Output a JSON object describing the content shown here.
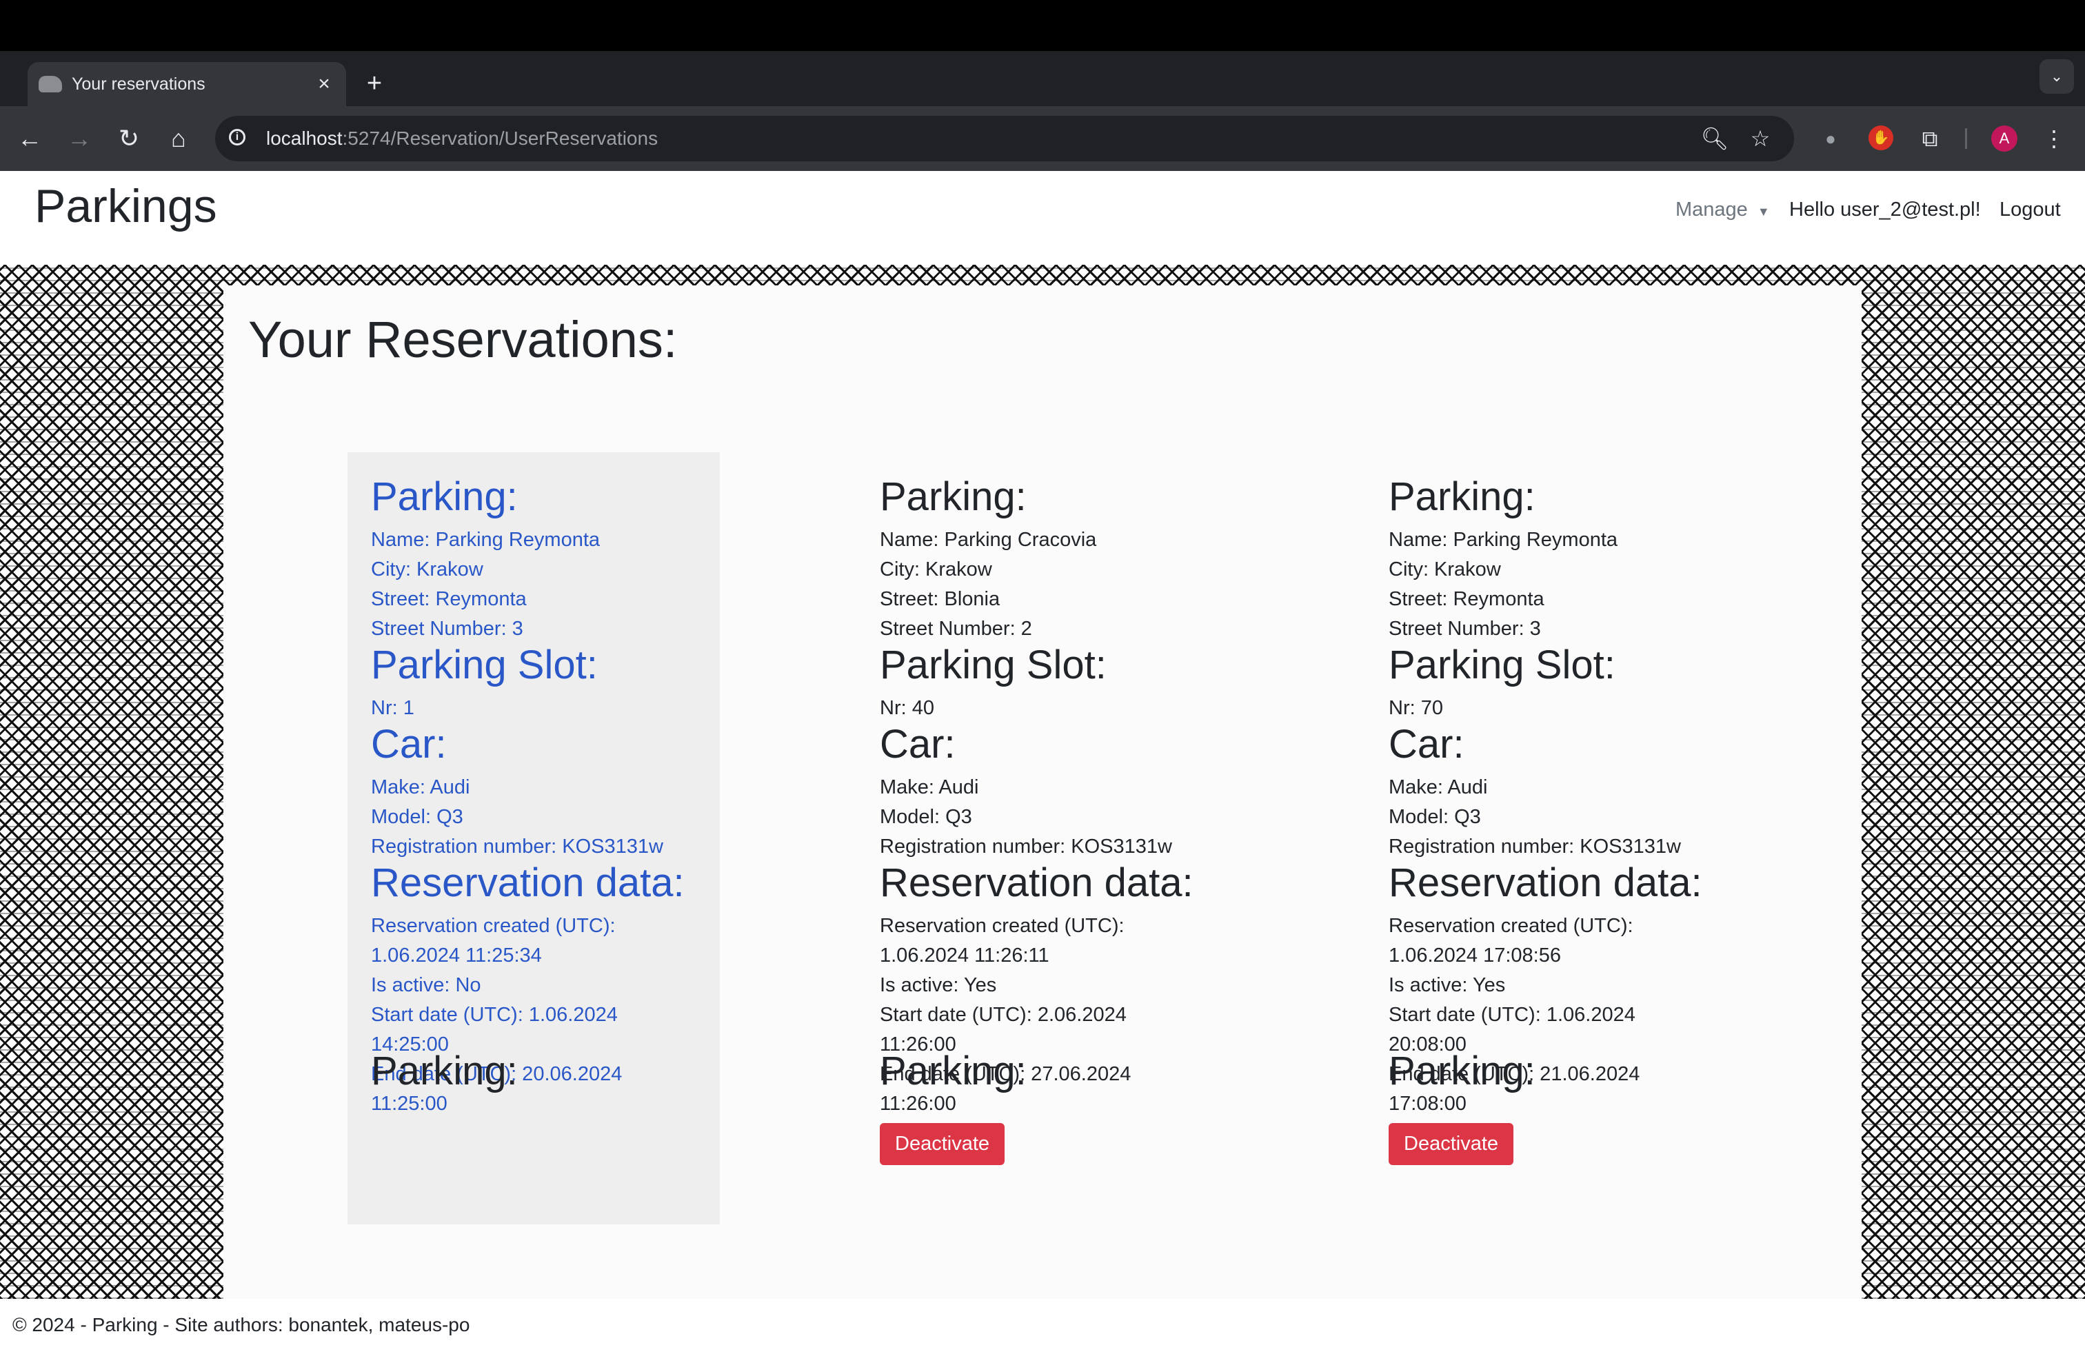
{
  "browser": {
    "tab_title": "Your reservations",
    "tab_close": "×",
    "new_tab": "+",
    "url_host": "localhost",
    "url_rest": ":5274/Reservation/UserReservations",
    "profile_initial": "A"
  },
  "navbar": {
    "brand": "Parkings",
    "manage_label": "Manage",
    "hello_text": "Hello user_2@test.pl!",
    "logout_label": "Logout"
  },
  "page": {
    "heading": "Your Reservations:"
  },
  "labels": {
    "parking": "Parking:",
    "parking_slot": "Parking Slot:",
    "car": "Car:",
    "reservation_data": "Reservation data:",
    "deactivate": "Deactivate"
  },
  "reservations": [
    {
      "name": "Name: Parking Reymonta",
      "city": "City: Krakow",
      "street": "Street: Reymonta",
      "street_number": "Street Number: 3",
      "slot_nr": "Nr: 1",
      "make": "Make: Audi",
      "model": "Model: Q3",
      "registration": "Registration number: KOS3131w",
      "created_label": "Reservation created (UTC):",
      "created": "1.06.2024 11:25:34",
      "is_active": "Is active: No",
      "start_1": "Start date (UTC): 1.06.2024",
      "start_2": "14:25:00",
      "end_1": "End date (UTC): 20.06.2024",
      "end_2": "11:25:00"
    },
    {
      "name": "Name: Parking Cracovia",
      "city": "City: Krakow",
      "street": "Street: Blonia",
      "street_number": "Street Number: 2",
      "slot_nr": "Nr: 40",
      "make": "Make: Audi",
      "model": "Model: Q3",
      "registration": "Registration number: KOS3131w",
      "created_label": "Reservation created (UTC):",
      "created": "1.06.2024 11:26:11",
      "is_active": "Is active: Yes",
      "start_1": "Start date (UTC): 2.06.2024",
      "start_2": "11:26:00",
      "end_1": "End date (UTC): 27.06.2024",
      "end_2": "11:26:00"
    },
    {
      "name": "Name: Parking Reymonta",
      "city": "City: Krakow",
      "street": "Street: Reymonta",
      "street_number": "Street Number: 3",
      "slot_nr": "Nr: 70",
      "make": "Make: Audi",
      "model": "Model: Q3",
      "registration": "Registration number: KOS3131w",
      "created_label": "Reservation created (UTC):",
      "created": "1.06.2024 17:08:56",
      "is_active": "Is active: Yes",
      "start_1": "Start date (UTC): 1.06.2024",
      "start_2": "20:08:00",
      "end_1": "End date (UTC): 21.06.2024",
      "end_2": "17:08:00"
    }
  ],
  "footer": {
    "text": "© 2024 - Parking - Site authors: bonantek, mateus-po"
  },
  "colors": {
    "inactive_text": "#2957c7",
    "inactive_bg": "#eeeeee",
    "danger": "#dc3545"
  }
}
